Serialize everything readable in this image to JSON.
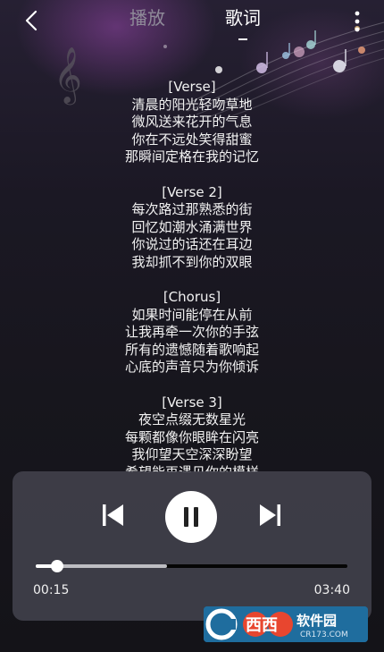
{
  "header": {
    "tab_play": "播放",
    "tab_lyrics": "歌词",
    "active_tab": "lyrics"
  },
  "lyrics": [
    {
      "tag": "[Verse]",
      "lines": [
        "清晨的阳光轻吻草地",
        "微风送来花开的气息",
        "你在不远处笑得甜蜜",
        "那瞬间定格在我的记忆"
      ]
    },
    {
      "tag": "[Verse 2]",
      "lines": [
        "每次路过那熟悉的街",
        "回忆如潮水涌满世界",
        "你说过的话还在耳边",
        "我却抓不到你的双眼"
      ]
    },
    {
      "tag": "[Chorus]",
      "lines": [
        "如果时间能停在从前",
        "让我再牵一次你的手弦",
        "所有的遗憾随着歌响起",
        "心底的声音只为你倾诉"
      ]
    },
    {
      "tag": "[Verse 3]",
      "lines": [
        "夜空点缀无数星光",
        "每颗都像你眼眸在闪亮",
        "我仰望天空深深盼望",
        "希望能再遇见你的模样"
      ]
    }
  ],
  "player": {
    "current_time": "00:15",
    "total_time": "03:40",
    "progress": 0.07,
    "buffered": 0.42,
    "state": "playing"
  },
  "watermark": {
    "logo_text": "西西软件园",
    "url_text": "CR173.COM"
  },
  "icons": {
    "back": "chevron-left-icon",
    "more": "more-vertical-icon",
    "prev": "skip-previous-icon",
    "pause": "pause-icon",
    "next": "skip-next-icon"
  },
  "colors": {
    "background": "#17161d",
    "panel": "#46464f",
    "inactive_tab": "#8f8b99",
    "text": "#ffffff"
  }
}
